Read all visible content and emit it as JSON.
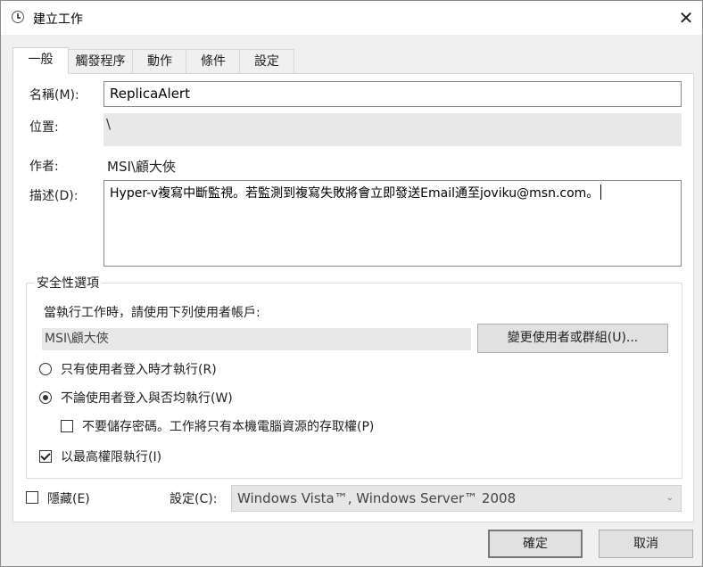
{
  "window": {
    "title": "建立工作",
    "close_label": "✕"
  },
  "tabs": [
    {
      "label": "一般",
      "active": true
    },
    {
      "label": "觸發程序",
      "active": false
    },
    {
      "label": "動作",
      "active": false
    },
    {
      "label": "條件",
      "active": false
    },
    {
      "label": "設定",
      "active": false
    }
  ],
  "general": {
    "name_label": "名稱(M):",
    "name_value": "ReplicaAlert",
    "location_label": "位置:",
    "location_value": "\\",
    "author_label": "作者:",
    "author_value": "MSI\\顧大俠",
    "description_label": "描述(D):",
    "description_value": "Hyper-v複寫中斷監視。若監測到複寫失敗將會立即發送Email通至joviku@msn.com。"
  },
  "security": {
    "group_title": "安全性選項",
    "prompt": "當執行工作時，請使用下列使用者帳戶:",
    "account_value": "MSI\\顧大俠",
    "change_user_button": "變更使用者或群組(U)...",
    "radio_logged_on": {
      "label": "只有使用者登入時才執行(R)",
      "checked": false
    },
    "radio_whether": {
      "label": "不論使用者登入與否均執行(W)",
      "checked": true
    },
    "no_store_password": {
      "label": "不要儲存密碼。工作將只有本機電腦資源的存取權(P)",
      "checked": false
    },
    "highest_privileges": {
      "label": "以最高權限執行(I)",
      "checked": true
    }
  },
  "footer_row": {
    "hidden": {
      "label": "隱藏(E)",
      "checked": false
    },
    "config_label": "設定(C):",
    "config_value": "Windows Vista™, Windows Server™ 2008"
  },
  "buttons": {
    "ok": "確定",
    "cancel": "取消"
  }
}
